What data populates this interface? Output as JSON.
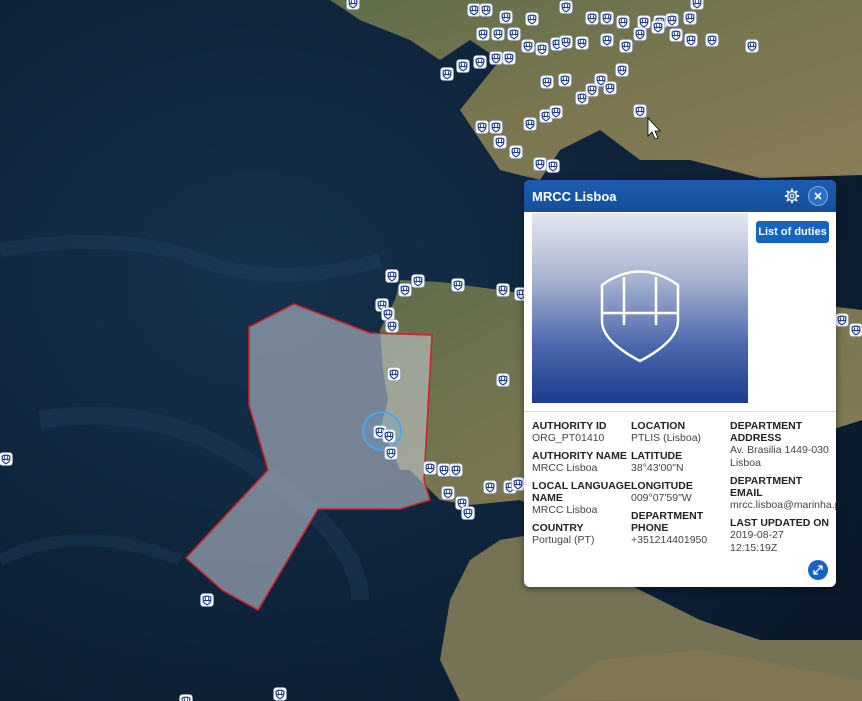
{
  "popup": {
    "title": "MRCC Lisboa",
    "duties_button": "List of duties",
    "fields_col1": [
      {
        "label": "AUTHORITY ID",
        "value": "ORG_PT01410"
      },
      {
        "label": "AUTHORITY NAME",
        "value": "MRCC Lisboa"
      },
      {
        "label": "LOCAL LANGUAGE NAME",
        "value": "MRCC Lisboa"
      },
      {
        "label": "COUNTRY",
        "value": "Portugal (PT)"
      }
    ],
    "fields_col2": [
      {
        "label": "LOCATION",
        "value": "PTLIS (Lisboa)"
      },
      {
        "label": "LATITUDE",
        "value": "38°43'00\"N"
      },
      {
        "label": "LONGITUDE",
        "value": "009°07'59\"W"
      },
      {
        "label": "DEPARTMENT PHONE",
        "value": "+351214401950"
      }
    ],
    "fields_col3": [
      {
        "label": "DEPARTMENT ADDRESS",
        "value": "Av. Brasilia 1449-030 Lisboa"
      },
      {
        "label": "DEPARTMENT EMAIL",
        "value": "mrcc.lisboa@marinha.pt"
      },
      {
        "label": "LAST UPDATED ON",
        "value": "2019-08-27 12:15:19Z"
      }
    ]
  },
  "colors": {
    "header_blue": "#1a5cb0",
    "button_blue": "#1565c0",
    "area_outline": "#d0202a",
    "marker_fill": "#ffffff",
    "marker_stroke": "#1b3d8f"
  },
  "icons": {
    "marker": "authority-shield-icon",
    "settings": "gear-icon",
    "close": "close-icon",
    "expand": "expand-icon",
    "cursor": "mouse-cursor-icon"
  }
}
